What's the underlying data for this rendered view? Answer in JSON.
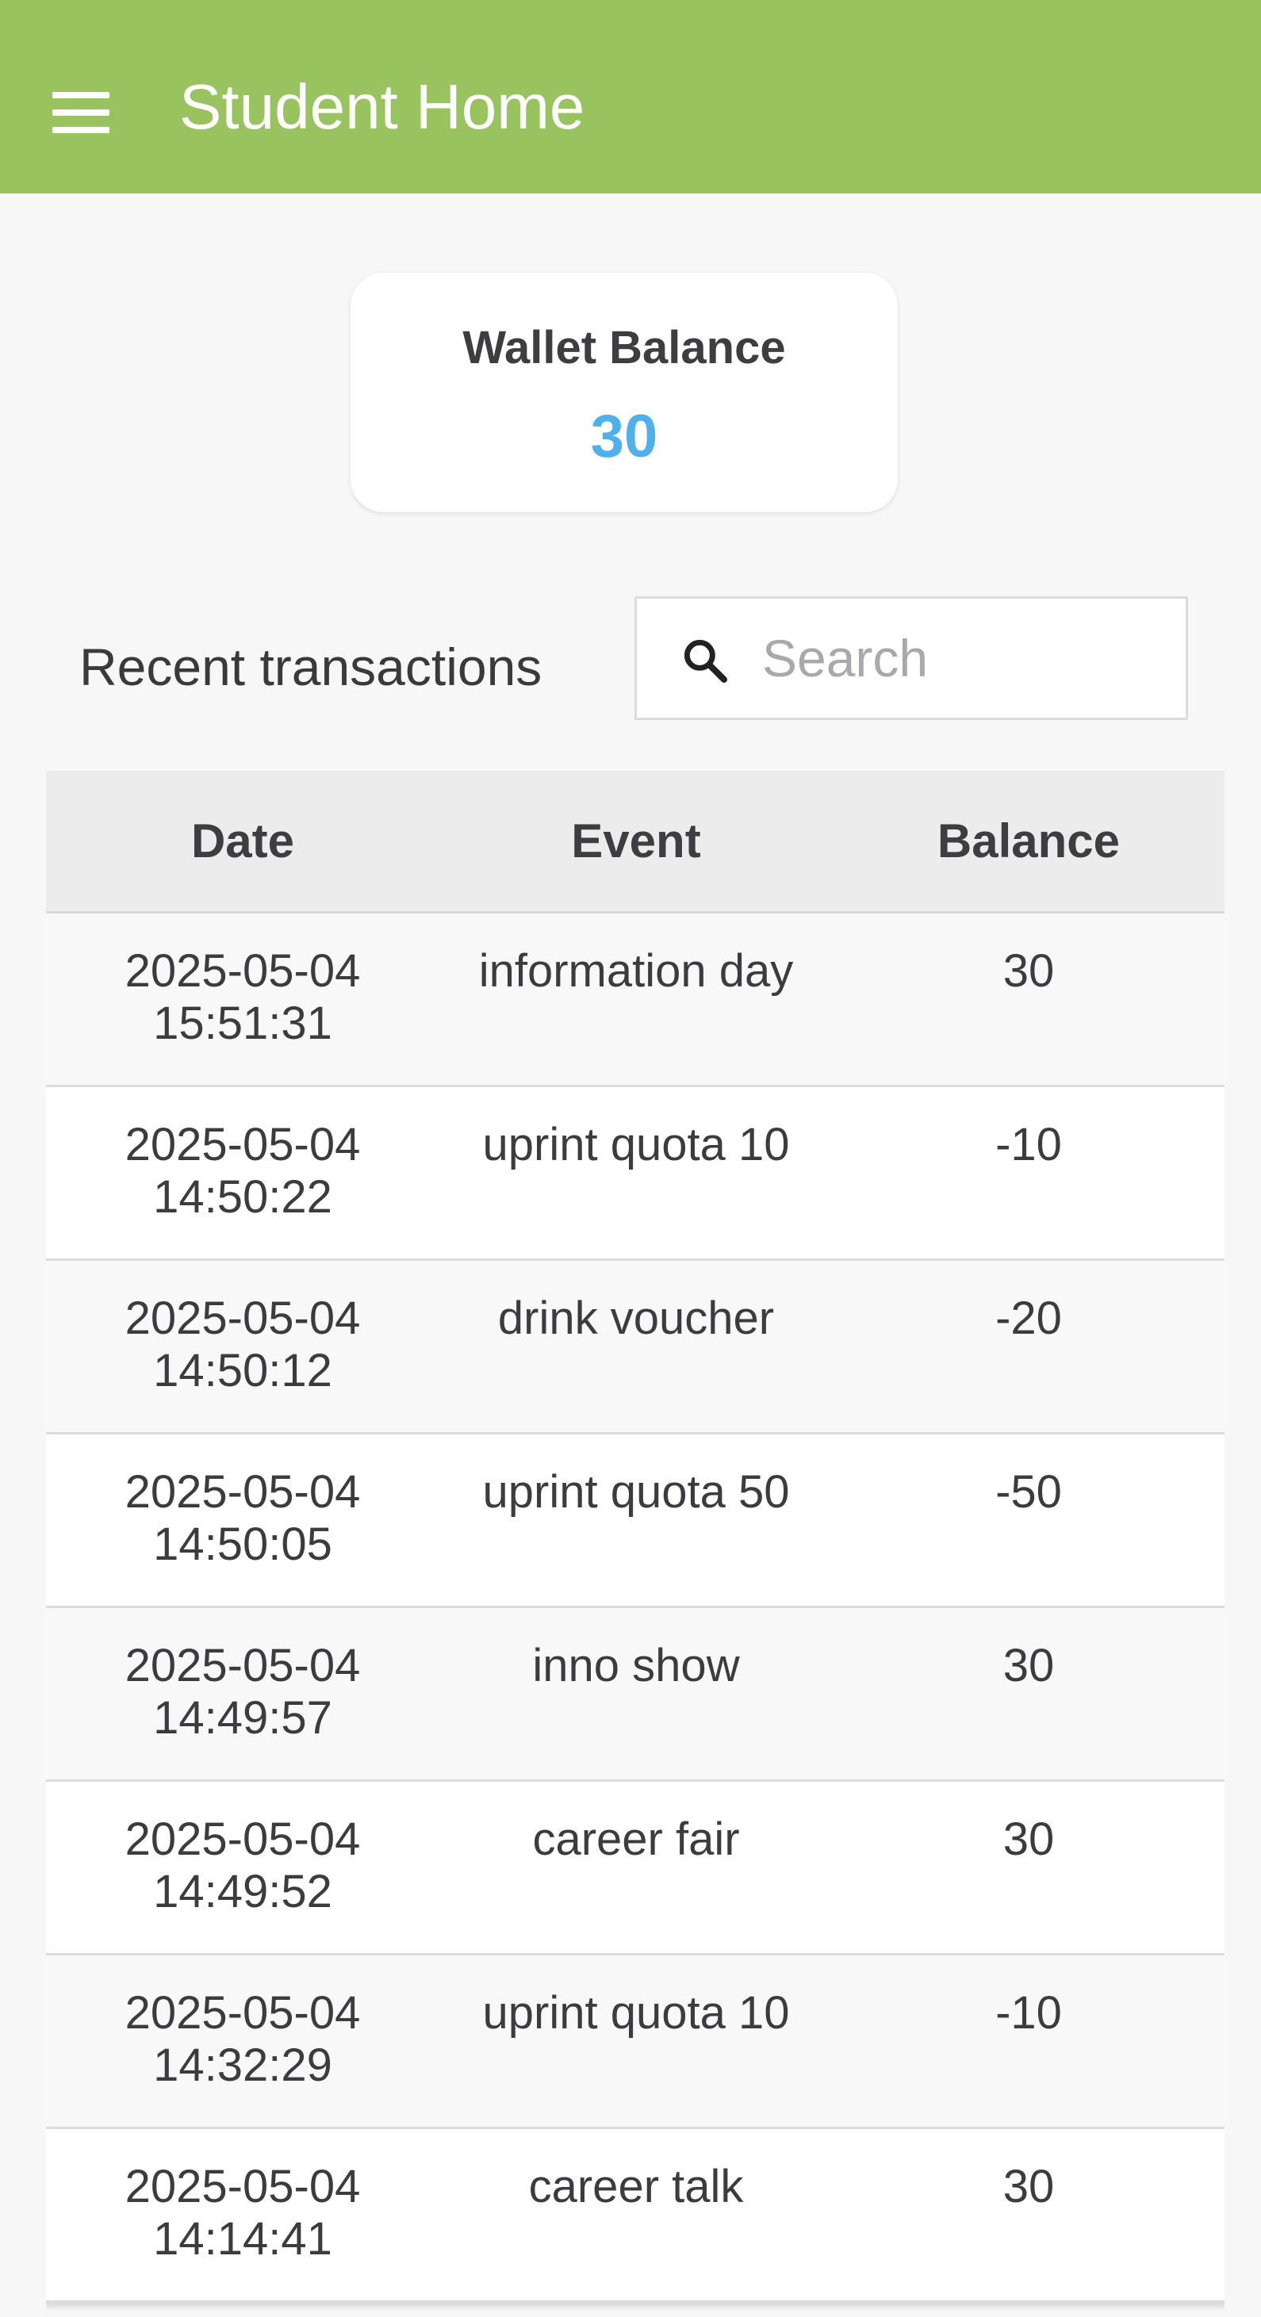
{
  "appbar": {
    "title": "Student Home",
    "menu_icon": "hamburger-menu-icon",
    "background_color": "#98c35e"
  },
  "wallet": {
    "label": "Wallet Balance",
    "value": "30",
    "value_color": "#4fb0ec"
  },
  "transactions": {
    "title": "Recent transactions",
    "search_placeholder": "Search",
    "search_icon": "search-icon",
    "columns": [
      "Date",
      "Event",
      "Balance"
    ],
    "rows": [
      {
        "date": "2025-05-04",
        "time": "15:51:31",
        "event": "information day",
        "balance": "30"
      },
      {
        "date": "2025-05-04",
        "time": "14:50:22",
        "event": "uprint quota 10",
        "balance": "-10"
      },
      {
        "date": "2025-05-04",
        "time": "14:50:12",
        "event": "drink voucher",
        "balance": "-20"
      },
      {
        "date": "2025-05-04",
        "time": "14:50:05",
        "event": "uprint quota 50",
        "balance": "-50"
      },
      {
        "date": "2025-05-04",
        "time": "14:49:57",
        "event": "inno show",
        "balance": "30"
      },
      {
        "date": "2025-05-04",
        "time": "14:49:52",
        "event": "career fair",
        "balance": "30"
      },
      {
        "date": "2025-05-04",
        "time": "14:32:29",
        "event": "uprint quota 10",
        "balance": "-10"
      },
      {
        "date": "2025-05-04",
        "time": "14:14:41",
        "event": "career talk",
        "balance": "30"
      }
    ]
  }
}
